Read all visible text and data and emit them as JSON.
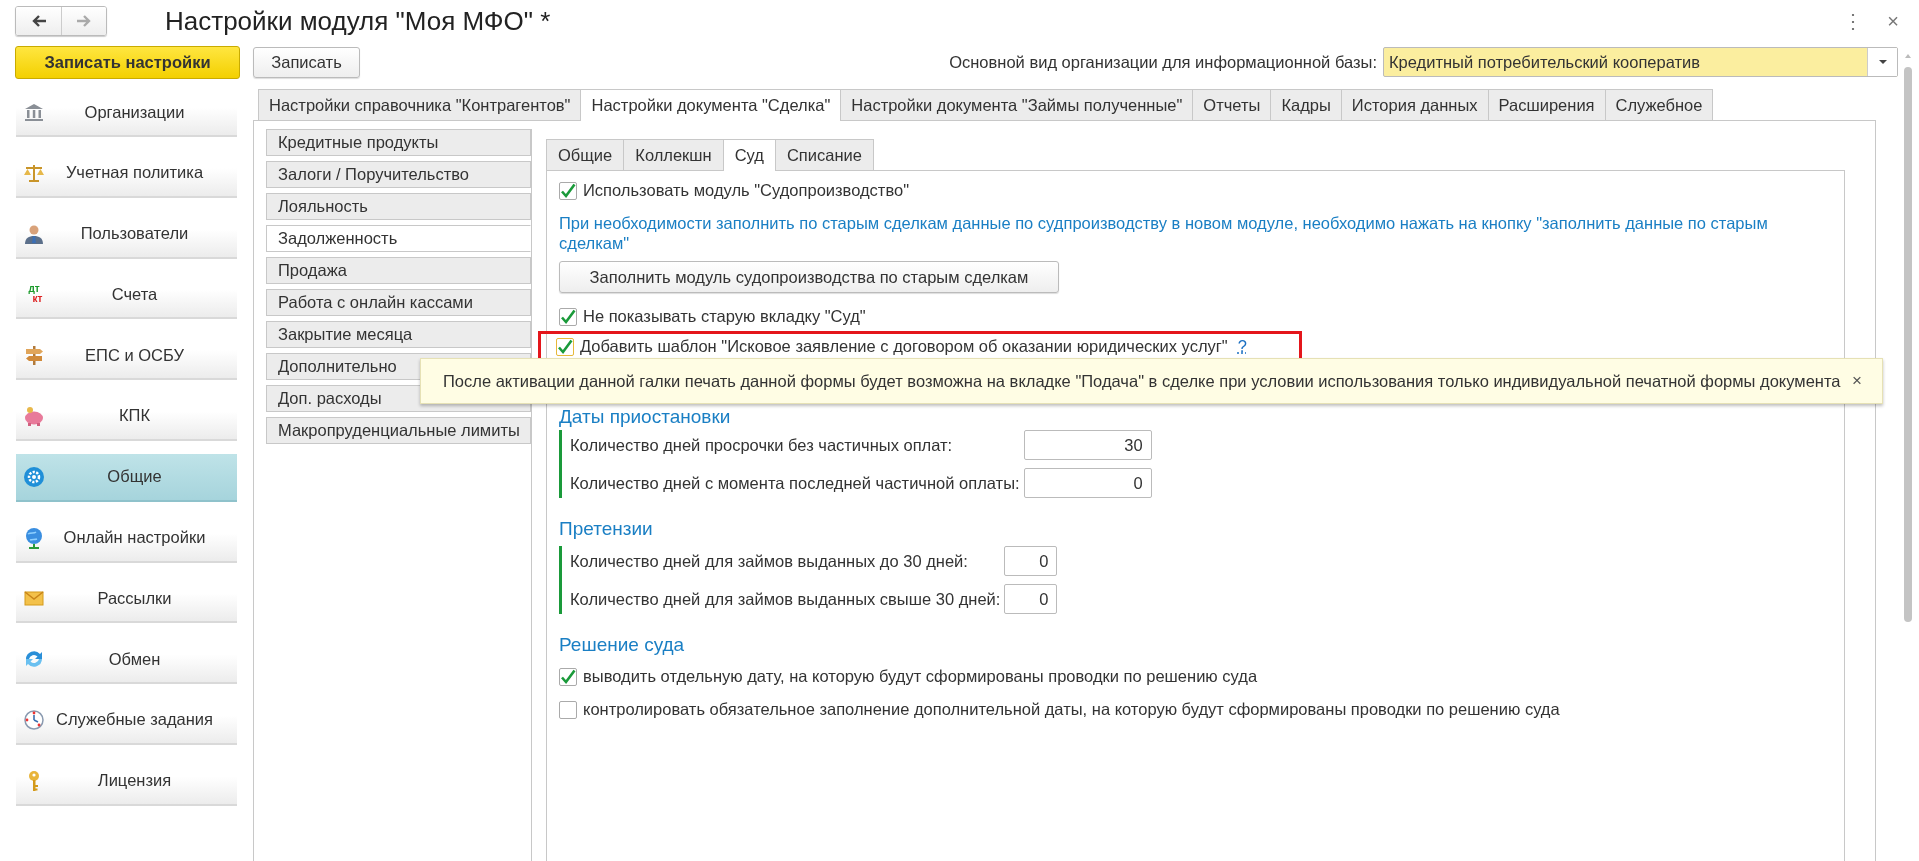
{
  "window": {
    "title": "Настройки модуля \"Моя МФО\" *",
    "nav": [
      {
        "kind": "back",
        "disabled": false
      },
      {
        "kind": "forward",
        "disabled": true
      }
    ],
    "controls": [
      "⋮",
      "×"
    ]
  },
  "toolbar": {
    "primary_button": "Записать настройки",
    "button": "Записать",
    "org_type": {
      "label": "Основной вид организации для информационной базы:",
      "value": "Кредитный потребительский кооператив"
    }
  },
  "sidebar": {
    "items": [
      {
        "label": "Организации",
        "selected": false
      },
      {
        "label": "Учетная политика",
        "selected": false
      },
      {
        "label": "Пользователи",
        "selected": false
      },
      {
        "label": "Счета",
        "icon_text": [
          "дт",
          "кт"
        ],
        "selected": false
      },
      {
        "label": "ЕПС и ОСБУ",
        "selected": false
      },
      {
        "label": "КПК",
        "selected": false
      },
      {
        "label": "Общие",
        "selected": true
      },
      {
        "label": "Онлайн настройки",
        "selected": false
      },
      {
        "label": "Рассылки",
        "selected": false
      },
      {
        "label": "Обмен",
        "selected": false
      },
      {
        "label": "Служебные задания",
        "selected": false
      },
      {
        "label": "Лицензия",
        "selected": false
      }
    ]
  },
  "tabs": [
    {
      "label": "Настройки справочника \"Контрагентов\"",
      "selected": false
    },
    {
      "label": "Настройки документа \"Сделка\"",
      "selected": true
    },
    {
      "label": "Настройки документа \"Займы полученные\"",
      "selected": false
    },
    {
      "label": "Отчеты",
      "selected": false
    },
    {
      "label": "Кадры",
      "selected": false
    },
    {
      "label": "История данных",
      "selected": false
    },
    {
      "label": "Расширения",
      "selected": false
    },
    {
      "label": "Служебное",
      "selected": false
    }
  ],
  "section_tabs": [
    {
      "label": "Кредитные продукты",
      "selected": false
    },
    {
      "label": "Залоги / Поручительство",
      "selected": false
    },
    {
      "label": "Лояльность",
      "selected": false
    },
    {
      "label": "Задолженность",
      "selected": true
    },
    {
      "label": "Продажа",
      "selected": false
    },
    {
      "label": "Работа с онлайн кассами",
      "selected": false
    },
    {
      "label": "Закрытие месяца",
      "selected": false
    },
    {
      "label": "Дополнительно",
      "selected": false
    },
    {
      "label": "Доп. расходы",
      "selected": false
    },
    {
      "label": "Макропруденциальные лимиты",
      "selected": false
    }
  ],
  "inner_tabs": [
    {
      "label": "Общие",
      "selected": false
    },
    {
      "label": "Коллекшн",
      "selected": false
    },
    {
      "label": "Суд",
      "selected": true
    },
    {
      "label": "Списание",
      "selected": false
    }
  ],
  "court": [
    {
      "kind": "checkbox",
      "label": "Использовать модуль \"Судопроизводство\"",
      "checked": true,
      "highlighted": false
    },
    {
      "kind": "note",
      "text": "При необходимости заполнить по старым сделкам данные по судпроизводству в новом модуле, необходимо нажать на кнопку \"заполнить данные по старым сделкам\""
    },
    {
      "kind": "button",
      "label": "Заполнить модуль судопроизводства по старым сделкам"
    },
    {
      "kind": "checkbox",
      "label": "Не показывать старую вкладку \"Суд\"",
      "checked": true,
      "highlighted": false
    },
    {
      "kind": "checkbox",
      "label": "Добавить шаблон \"Исковое заявление с договором об оказании юридических услуг\"",
      "help": "?",
      "checked": true,
      "highlighted": true
    },
    {
      "kind": "group",
      "title": "Даты приостановки",
      "fields": [
        {
          "label": "Количество дней просрочки без частичных оплат:",
          "value": "30"
        },
        {
          "label": "Количество дней с момента последней частичной оплаты:",
          "value": "0"
        }
      ]
    },
    {
      "kind": "group",
      "title": "Претензии",
      "fields": [
        {
          "label": "Количество дней для займов выданных до 30 дней:",
          "value": "0"
        },
        {
          "label": "Количество дней для займов выданных свыше 30 дней:",
          "value": "0"
        }
      ]
    },
    {
      "kind": "heading",
      "title": "Решение суда"
    },
    {
      "kind": "checkbox",
      "label": "выводить отдельную дату, на которую будут сформированы проводки по решению суда",
      "checked": true,
      "highlighted": false
    },
    {
      "kind": "checkbox",
      "label": "контролировать обязательное заполнение дополнительной даты, на которую будут сформированы проводки по решению суда",
      "checked": false,
      "highlighted": false
    }
  ],
  "tooltip": {
    "text": "После активации данной галки печать данной формы будет возможна на вкладке \"Подача\" в сделке при условии использования только индивидуальной печатной формы документа",
    "close": "×"
  }
}
